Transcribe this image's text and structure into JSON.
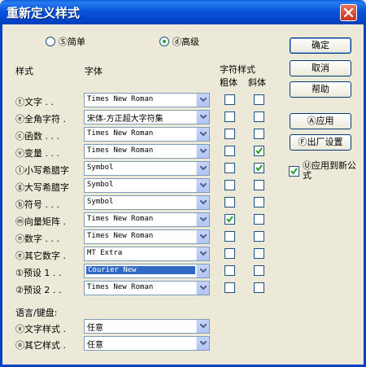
{
  "window": {
    "title": "重新定义样式"
  },
  "mode": {
    "simple_label": "Ⓢ简单",
    "advanced_label": "ⓓ高级",
    "selected": "advanced"
  },
  "headers": {
    "style": "样式",
    "font": "字体",
    "char_style": "字符样式",
    "bold": "粗体",
    "italic": "斜体"
  },
  "rows": [
    {
      "label": "ⓣ文字 . .",
      "font": "Times New Roman",
      "bold": false,
      "italic": false
    },
    {
      "label": "ⓔ全角字符 .",
      "font": "宋体-方正超大字符集",
      "bold": false,
      "italic": false
    },
    {
      "label": "ⓒ函数 . . .",
      "font": "Times New Roman",
      "bold": false,
      "italic": false
    },
    {
      "label": "ⓥ变量 . . .",
      "font": "Times New Roman",
      "bold": false,
      "italic": true
    },
    {
      "label": "ⓛ小写希腊字",
      "font": "Symbol",
      "bold": false,
      "italic": true
    },
    {
      "label": "ⓖ大写希腊字",
      "font": "Symbol",
      "bold": false,
      "italic": false
    },
    {
      "label": "ⓑ符号 . . .",
      "font": "Symbol",
      "bold": false,
      "italic": false
    },
    {
      "label": "ⓜ向量矩阵 .",
      "font": "Times New Roman",
      "bold": true,
      "italic": false
    },
    {
      "label": "ⓝ数字 . . .",
      "font": "Times New Roman",
      "bold": false,
      "italic": false
    },
    {
      "label": "ⓔ其它数字 .",
      "font": "MT Extra",
      "bold": false,
      "italic": false
    },
    {
      "label": "①预设 1 . .",
      "font": "Courier New",
      "bold": false,
      "italic": false,
      "selected": true
    },
    {
      "label": "②预设 2 . .",
      "font": "Times New Roman",
      "bold": false,
      "italic": false
    }
  ],
  "language": {
    "header": "语言/键盘:",
    "text_style_label": "ⓧ文字样式 .",
    "text_style_value": "任意",
    "other_style_label": "ⓞ其它样式 .",
    "other_style_value": "任意"
  },
  "buttons": {
    "ok": "确定",
    "cancel": "取消",
    "help": "帮助",
    "apply": "Ⓐ应用",
    "factory": "Ⓕ出厂设置"
  },
  "apply_new": {
    "label": "Ⓤ应用到新公式",
    "checked": true
  },
  "colors": {
    "title_bar": "#0855dd",
    "dialog_bg": "#ece9d8",
    "check_green": "#21a121",
    "selection": "#316ac5"
  }
}
